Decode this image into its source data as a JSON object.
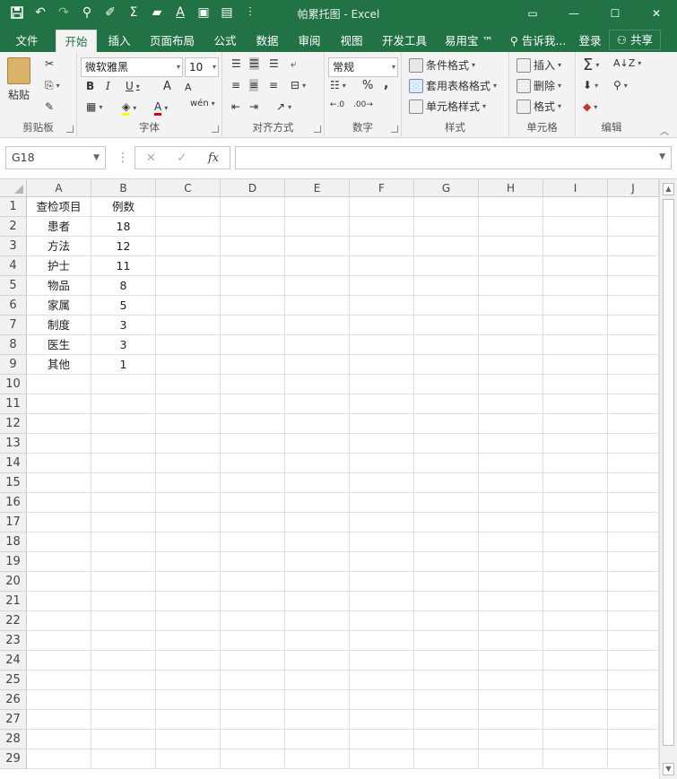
{
  "window": {
    "title": "帕累托图 - Excel",
    "controls": {
      "restore": "▭",
      "minimize": "—",
      "maximize": "☐",
      "close": "✕"
    }
  },
  "qat": {
    "more": "⫶"
  },
  "tabs": [
    {
      "label": "文件"
    },
    {
      "label": "开始"
    },
    {
      "label": "插入"
    },
    {
      "label": "页面布局"
    },
    {
      "label": "公式"
    },
    {
      "label": "数据"
    },
    {
      "label": "审阅"
    },
    {
      "label": "视图"
    },
    {
      "label": "开发工具"
    },
    {
      "label": "易用宝 ™"
    }
  ],
  "tellme": "告诉我...",
  "signin": "登录",
  "share": "共享",
  "ribbon": {
    "clipboard": {
      "label": "剪贴板",
      "paste": "粘贴"
    },
    "font": {
      "label": "字体",
      "name": "微软雅黑",
      "size": "10",
      "bold": "B",
      "italic": "I",
      "underline": "U",
      "grow": "A",
      "shrink": "A",
      "wen": "wén"
    },
    "alignment": {
      "label": "对齐方式"
    },
    "number": {
      "label": "数字",
      "format": "常规",
      "percent": "%",
      "comma": ","
    },
    "styles": {
      "label": "样式",
      "conditional": "条件格式",
      "table": "套用表格格式",
      "cell": "单元格样式"
    },
    "cells": {
      "label": "单元格",
      "insert": "插入",
      "delete": "删除",
      "format": "格式"
    },
    "editing": {
      "label": "编辑"
    }
  },
  "formula_bar": {
    "name_box": "G18",
    "fx": "fx",
    "value": ""
  },
  "columns": [
    "A",
    "B",
    "C",
    "D",
    "E",
    "F",
    "G",
    "H",
    "I",
    "J"
  ],
  "rows": [
    "1",
    "2",
    "3",
    "4",
    "5",
    "6",
    "7",
    "8",
    "9",
    "10",
    "11",
    "12",
    "13",
    "14",
    "15",
    "16",
    "17",
    "18",
    "19",
    "20",
    "21",
    "22",
    "23",
    "24",
    "25",
    "26",
    "27",
    "28",
    "29"
  ],
  "sheet": {
    "A": [
      "查检项目",
      "患者",
      "方法",
      "护士",
      "物品",
      "家属",
      "制度",
      "医生",
      "其他"
    ],
    "B": [
      "例数",
      "18",
      "12",
      "11",
      "8",
      "5",
      "3",
      "3",
      "1"
    ]
  },
  "colors": {
    "excel_green": "#217346",
    "ribbon_bg": "#f3f3f3"
  }
}
